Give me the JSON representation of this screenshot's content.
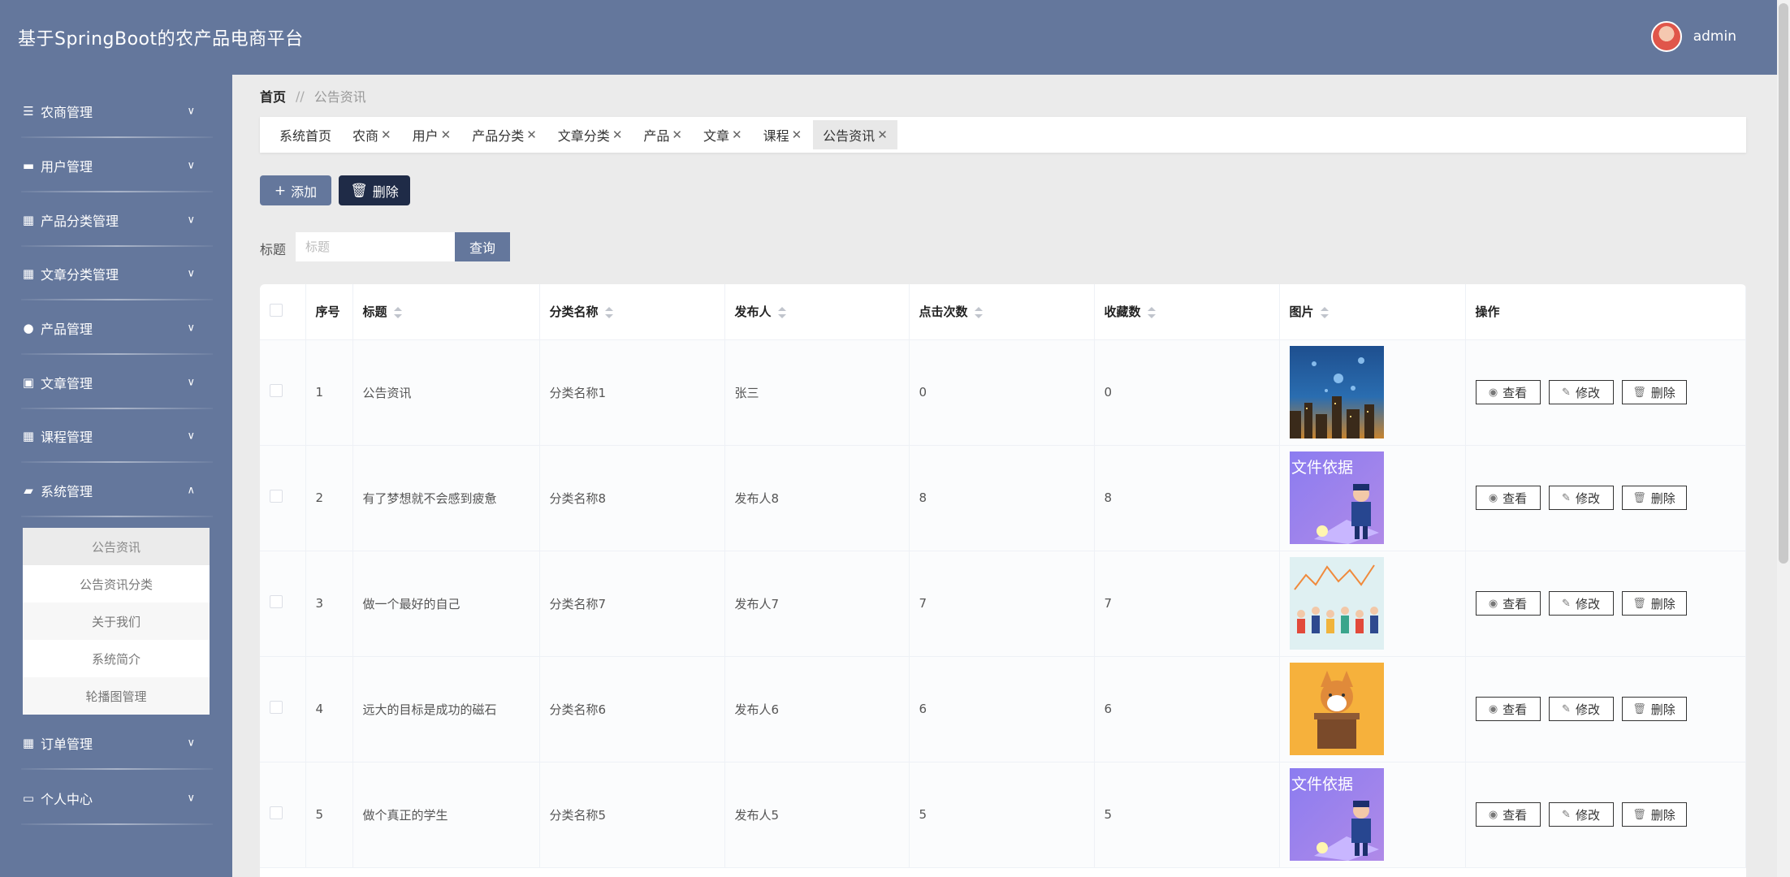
{
  "app": {
    "title": "基于SpringBoot的农产品电商平台",
    "user": "admin"
  },
  "sidebar": {
    "items": [
      {
        "label": "农商管理",
        "icon": "sliders-icon"
      },
      {
        "label": "用户管理",
        "icon": "briefcase-icon"
      },
      {
        "label": "产品分类管理",
        "icon": "grid-icon"
      },
      {
        "label": "文章分类管理",
        "icon": "grid-icon"
      },
      {
        "label": "产品管理",
        "icon": "person-icon"
      },
      {
        "label": "文章管理",
        "icon": "clipboard-icon"
      },
      {
        "label": "课程管理",
        "icon": "grid-icon"
      },
      {
        "label": "系统管理",
        "icon": "chat-icon"
      },
      {
        "label": "订单管理",
        "icon": "grid-icon"
      },
      {
        "label": "个人中心",
        "icon": "window-icon"
      }
    ],
    "submenu": [
      "公告资讯",
      "公告资讯分类",
      "关于我们",
      "系统简介",
      "轮播图管理"
    ]
  },
  "breadcrumb": {
    "home": "首页",
    "sep": "//",
    "current": "公告资讯"
  },
  "tabs": [
    {
      "label": "系统首页",
      "closable": false
    },
    {
      "label": "农商",
      "closable": true
    },
    {
      "label": "用户",
      "closable": true
    },
    {
      "label": "产品分类",
      "closable": true
    },
    {
      "label": "文章分类",
      "closable": true
    },
    {
      "label": "产品",
      "closable": true
    },
    {
      "label": "文章",
      "closable": true
    },
    {
      "label": "课程",
      "closable": true
    },
    {
      "label": "公告资讯",
      "closable": true
    }
  ],
  "toolbar": {
    "add": "添加",
    "delete": "删除"
  },
  "search": {
    "label": "标题",
    "placeholder": "标题",
    "button": "查询"
  },
  "table": {
    "headers": [
      "序号",
      "标题",
      "分类名称",
      "发布人",
      "点击次数",
      "收藏数",
      "图片",
      "操作"
    ],
    "rows": [
      {
        "no": "1",
        "title": "公告资讯",
        "category": "分类名称1",
        "publisher": "张三",
        "clicks": "0",
        "favorites": "0",
        "image": "city-night"
      },
      {
        "no": "2",
        "title": "有了梦想就不会感到疲惫",
        "category": "分类名称8",
        "publisher": "发布人8",
        "clicks": "8",
        "favorites": "8",
        "image": "document-police"
      },
      {
        "no": "3",
        "title": "做一个最好的自己",
        "category": "分类名称7",
        "publisher": "发布人7",
        "clicks": "7",
        "favorites": "7",
        "image": "crowd-chart"
      },
      {
        "no": "4",
        "title": "远大的目标是成功的磁石",
        "category": "分类名称6",
        "publisher": "发布人6",
        "clicks": "6",
        "favorites": "6",
        "image": "corgi-podium"
      },
      {
        "no": "5",
        "title": "做个真正的学生",
        "category": "分类名称5",
        "publisher": "发布人5",
        "clicks": "5",
        "favorites": "5",
        "image": "document-police"
      }
    ],
    "actions": {
      "view": "查看",
      "edit": "修改",
      "delete": "删除"
    },
    "image_text": "文件依据"
  }
}
